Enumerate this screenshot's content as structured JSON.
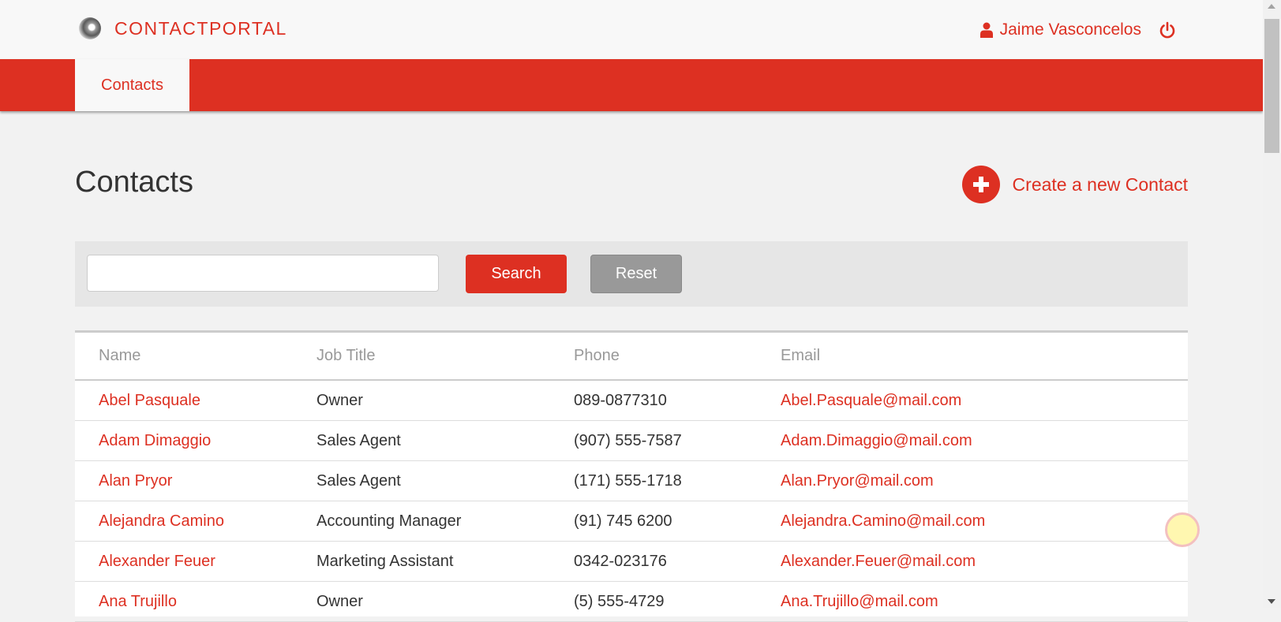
{
  "header": {
    "brand": "CONTACTPORTAL",
    "user_name": "Jaime Vasconcelos",
    "logout_icon": "power-icon",
    "user_icon": "user-icon"
  },
  "nav": {
    "tabs": [
      {
        "label": "Contacts",
        "active": true
      }
    ]
  },
  "main": {
    "title": "Contacts",
    "create_label": "Create a new Contact",
    "create_icon": "plus-circle-icon"
  },
  "search": {
    "value": "",
    "placeholder": "",
    "search_label": "Search",
    "reset_label": "Reset"
  },
  "table": {
    "columns": [
      "Name",
      "Job Title",
      "Phone",
      "Email"
    ],
    "rows": [
      {
        "name": "Abel Pasquale",
        "job": "Owner",
        "phone": "089-0877310",
        "email": "Abel.Pasquale@mail.com"
      },
      {
        "name": "Adam Dimaggio",
        "job": "Sales Agent",
        "phone": "(907) 555-7587",
        "email": "Adam.Dimaggio@mail.com"
      },
      {
        "name": "Alan Pryor",
        "job": "Sales Agent",
        "phone": "(171) 555-1718",
        "email": "Alan.Pryor@mail.com"
      },
      {
        "name": "Alejandra Camino",
        "job": "Accounting Manager",
        "phone": "(91) 745 6200",
        "email": "Alejandra.Camino@mail.com"
      },
      {
        "name": "Alexander Feuer",
        "job": "Marketing Assistant",
        "phone": "0342-023176",
        "email": "Alexander.Feuer@mail.com"
      },
      {
        "name": "Ana Trujillo",
        "job": "Owner",
        "phone": "(5) 555-4729",
        "email": "Ana.Trujillo@mail.com"
      }
    ]
  },
  "colors": {
    "accent": "#dd3022",
    "header_bg": "#f8f8f8",
    "page_bg": "#f2f2f2",
    "reset_bg": "#999999"
  }
}
